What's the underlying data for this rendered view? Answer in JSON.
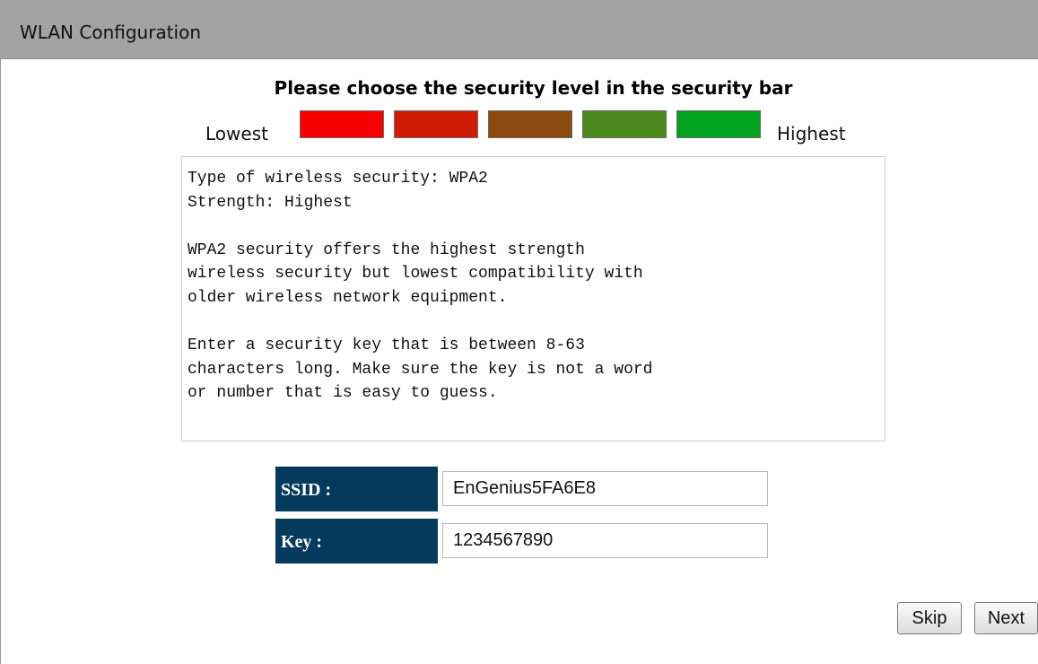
{
  "header": {
    "title": "WLAN Configuration"
  },
  "security": {
    "heading": "Please choose the security level in the security bar",
    "lowest_label": "Lowest",
    "highest_label": "Highest",
    "levels": [
      {
        "name": "level-1",
        "color": "#f80000"
      },
      {
        "name": "level-2",
        "color": "#d01c04"
      },
      {
        "name": "level-3",
        "color": "#8c4a10"
      },
      {
        "name": "level-4",
        "color": "#4a8a1c"
      },
      {
        "name": "level-5",
        "color": "#00a21e"
      }
    ],
    "description": "Type of wireless security: WPA2\nStrength: Highest\n\nWPA2 security offers the highest strength\nwireless security but lowest compatibility with\nolder wireless network equipment.\n\nEnter a security key that is between 8-63\ncharacters long. Make sure the key is not a word\nor number that is easy to guess."
  },
  "form": {
    "ssid_label": "SSID :",
    "ssid_value": "EnGenius5FA6E8",
    "key_label": "Key :",
    "key_value": "1234567890"
  },
  "buttons": {
    "skip": "Skip",
    "next": "Next"
  }
}
